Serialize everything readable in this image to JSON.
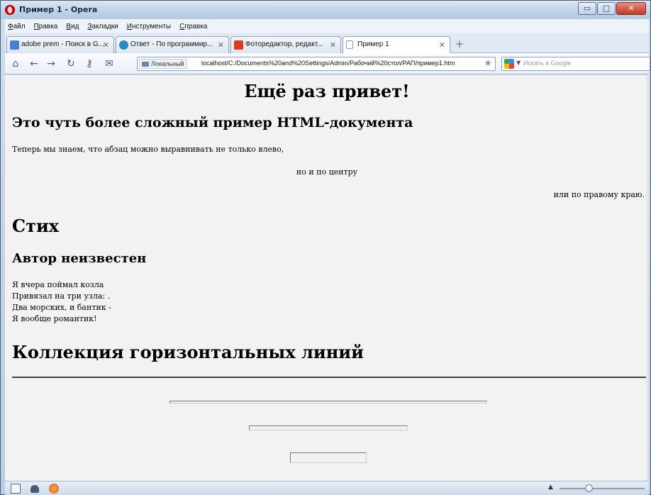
{
  "window": {
    "title": "Пример 1 - Opera",
    "controls": {
      "minimize": "▭",
      "maximize": "□",
      "close": "✕"
    }
  },
  "menu": {
    "items": [
      {
        "label_u": "Ф",
        "label_rest": "айл"
      },
      {
        "label_u": "П",
        "label_rest": "равка"
      },
      {
        "label_u": "В",
        "label_rest": "ид"
      },
      {
        "label_u": "З",
        "label_rest": "акладки"
      },
      {
        "label_u": "И",
        "label_rest": "нструменты"
      },
      {
        "label_u": "С",
        "label_rest": "правка"
      }
    ]
  },
  "tabs": [
    {
      "label": "adobe prem - Поиск в G...",
      "icon": "google-icon",
      "icon_color": "#4a7fd6",
      "close": "✕"
    },
    {
      "label": "Ответ - По программир...",
      "icon": "answer-site-icon",
      "icon_color": "#2a8ac6",
      "close": "✕"
    },
    {
      "label": "Фоторедактор, редакт...",
      "icon": "adobe-icon",
      "icon_color": "#e03a1e",
      "close": "✕"
    },
    {
      "label": "Пример 1",
      "icon": "page-icon",
      "icon_color": "#ffffff",
      "close": "✕"
    }
  ],
  "new_tab_glyph": "+",
  "address": {
    "nav": {
      "home": "⌂",
      "back": "←",
      "forward": "→",
      "reload": "↻",
      "key": "⚷",
      "mail": "✉"
    },
    "local_label": "Локальный",
    "url": "localhost/C:/Documents%20and%20Settings/Admin/Рабочий%20стол/РАП/пример1.htm",
    "star": "★"
  },
  "search": {
    "placeholder": "Искать в Google",
    "arrow": "▼"
  },
  "page": {
    "h1": "Ещё раз привет!",
    "h2_intro": "Это чуть более сложный пример HTML-документа",
    "p_left": "Теперь мы знаем, что абзац можно выравнивать не только влево,",
    "p_center": "но и по центру",
    "p_right": "или по правому краю.",
    "h2_poem": "Стих",
    "h3_author": "Автор неизвестен",
    "poem": [
      "Я вчера поймал козла",
      "Привязал на три узла: .",
      "Два морских, и бантик -",
      "Я вообще романтик!"
    ],
    "h2_lines": "Коллекция горизонтальных линий"
  },
  "statusbar": {
    "zoom_up": "▲"
  }
}
